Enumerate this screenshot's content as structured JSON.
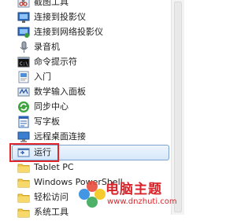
{
  "menu": {
    "items": [
      {
        "label": "截图工具",
        "icon": "scissors-icon"
      },
      {
        "label": "连接到投影仪",
        "icon": "projector-icon"
      },
      {
        "label": "连接到网络投影仪",
        "icon": "network-projector-icon"
      },
      {
        "label": "录音机",
        "icon": "microphone-icon"
      },
      {
        "label": "命令提示符",
        "icon": "command-prompt-icon"
      },
      {
        "label": "入门",
        "icon": "getting-started-icon"
      },
      {
        "label": "数学输入面板",
        "icon": "math-input-icon"
      },
      {
        "label": "同步中心",
        "icon": "sync-center-icon"
      },
      {
        "label": "写字板",
        "icon": "wordpad-icon"
      },
      {
        "label": "远程桌面连接",
        "icon": "remote-desktop-icon"
      },
      {
        "label": "运行",
        "icon": "run-icon"
      },
      {
        "label": "Tablet PC",
        "icon": "folder-icon"
      },
      {
        "label": "Windows PowerShell",
        "icon": "folder-icon"
      },
      {
        "label": "轻松访问",
        "icon": "folder-icon"
      },
      {
        "label": "系统工具",
        "icon": "folder-icon"
      }
    ],
    "selected_index": 10
  },
  "watermark": {
    "title": "电脑主题",
    "url": "www.dnzhuti.com"
  },
  "colors": {
    "selection_border": "#7da2ce",
    "highlight_box": "#e0262b",
    "watermark": "#d8242a"
  }
}
